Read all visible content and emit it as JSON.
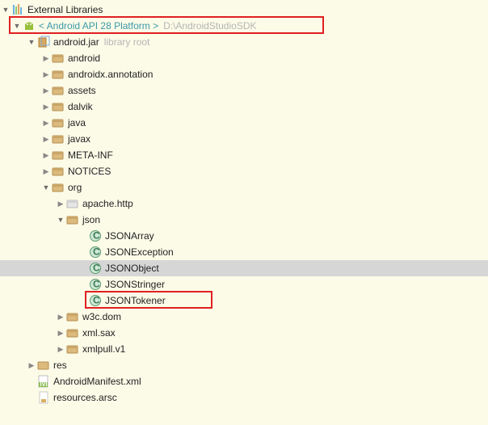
{
  "root": {
    "label": "External Libraries"
  },
  "platform": {
    "label": "< Android API 28 Platform >",
    "path": "D:\\AndroidStudioSDK"
  },
  "jar": {
    "name": "android.jar",
    "note": "library root"
  },
  "pkgs_top": [
    "android",
    "androidx.annotation",
    "assets",
    "dalvik",
    "java",
    "javax",
    "META-INF",
    "NOTICES"
  ],
  "org": {
    "label": "org"
  },
  "apache": {
    "label": "apache.http"
  },
  "json": {
    "label": "json",
    "classes": [
      "JSONArray",
      "JSONException",
      "JSONObject",
      "JSONStringer",
      "JSONTokener"
    ]
  },
  "pkgs_after_json": [
    "w3c.dom",
    "xml.sax",
    "xmlpull.v1"
  ],
  "res": {
    "label": "res"
  },
  "manifest": {
    "label": "AndroidManifest.xml"
  },
  "arsc": {
    "label": "resources.arsc"
  },
  "selected_class": "JSONObject"
}
